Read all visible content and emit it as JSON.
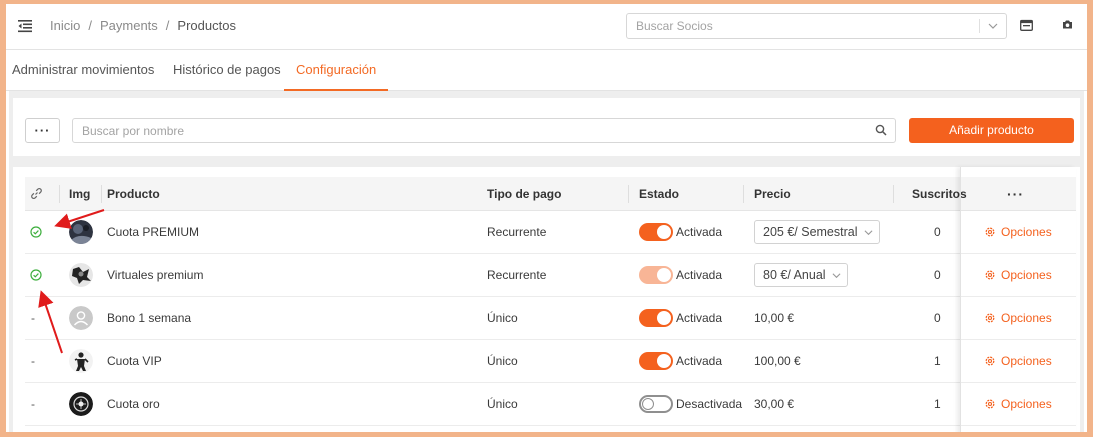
{
  "breadcrumb": [
    "Inicio",
    "/",
    "Payments",
    "/",
    "Productos"
  ],
  "partner_search": {
    "placeholder": "Buscar Socios"
  },
  "tabs": [
    {
      "label": "Administrar movimientos",
      "active": false
    },
    {
      "label": "Histórico de pagos",
      "active": false
    },
    {
      "label": "Configuración",
      "active": true
    }
  ],
  "toolbar": {
    "more_label": "···",
    "search_placeholder": "Buscar por nombre",
    "add_label": "Añadir producto"
  },
  "table": {
    "columns": [
      "Img",
      "Producto",
      "Tipo de pago",
      "Estado",
      "Precio",
      "Suscritos",
      "···"
    ],
    "rows": [
      {
        "linked": true,
        "link": "",
        "avatar": "photo-dark",
        "producto": "Cuota PREMIUM",
        "tipo": "Recurrente",
        "estado_on": true,
        "faded": false,
        "estado": "Activada",
        "precio": "205 €/ Semestral",
        "precio_select": true,
        "suscritos": "0",
        "opciones": "Opciones"
      },
      {
        "linked": true,
        "link": "",
        "avatar": "photo-bw",
        "producto": "Virtuales premium",
        "tipo": "Recurrente",
        "estado_on": true,
        "faded": true,
        "estado": "Activada",
        "precio": "80 €/ Anual",
        "precio_select": true,
        "suscritos": "0",
        "opciones": "Opciones"
      },
      {
        "linked": false,
        "link": "-",
        "avatar": "placeholder-user",
        "producto": "Bono 1 semana",
        "tipo": "Único",
        "estado_on": true,
        "faded": false,
        "estado": "Activada",
        "precio": "10,00 €",
        "precio_select": false,
        "suscritos": "0",
        "opciones": "Opciones"
      },
      {
        "linked": false,
        "link": "-",
        "avatar": "photo-figure",
        "producto": "Cuota VIP",
        "tipo": "Único",
        "estado_on": true,
        "faded": false,
        "estado": "Activada",
        "precio": "100,00 €",
        "precio_select": false,
        "suscritos": "1",
        "opciones": "Opciones"
      },
      {
        "linked": false,
        "link": "-",
        "avatar": "photo-logo",
        "producto": "Cuota oro",
        "tipo": "Único",
        "estado_on": false,
        "faded": false,
        "estado": "Desactivada",
        "precio": "30,00 €",
        "precio_select": false,
        "suscritos": "1",
        "opciones": "Opciones"
      }
    ]
  },
  "colors": {
    "accent": "#f4611e",
    "check": "#3dae3d",
    "annotation": "#e01b1b",
    "frame": "#f2b48a"
  },
  "icons": [
    "menu-icon",
    "chevron-down-icon",
    "calendar-icon",
    "camera-icon",
    "search-icon",
    "link-icon",
    "check-circle-icon",
    "gear-icon"
  ]
}
